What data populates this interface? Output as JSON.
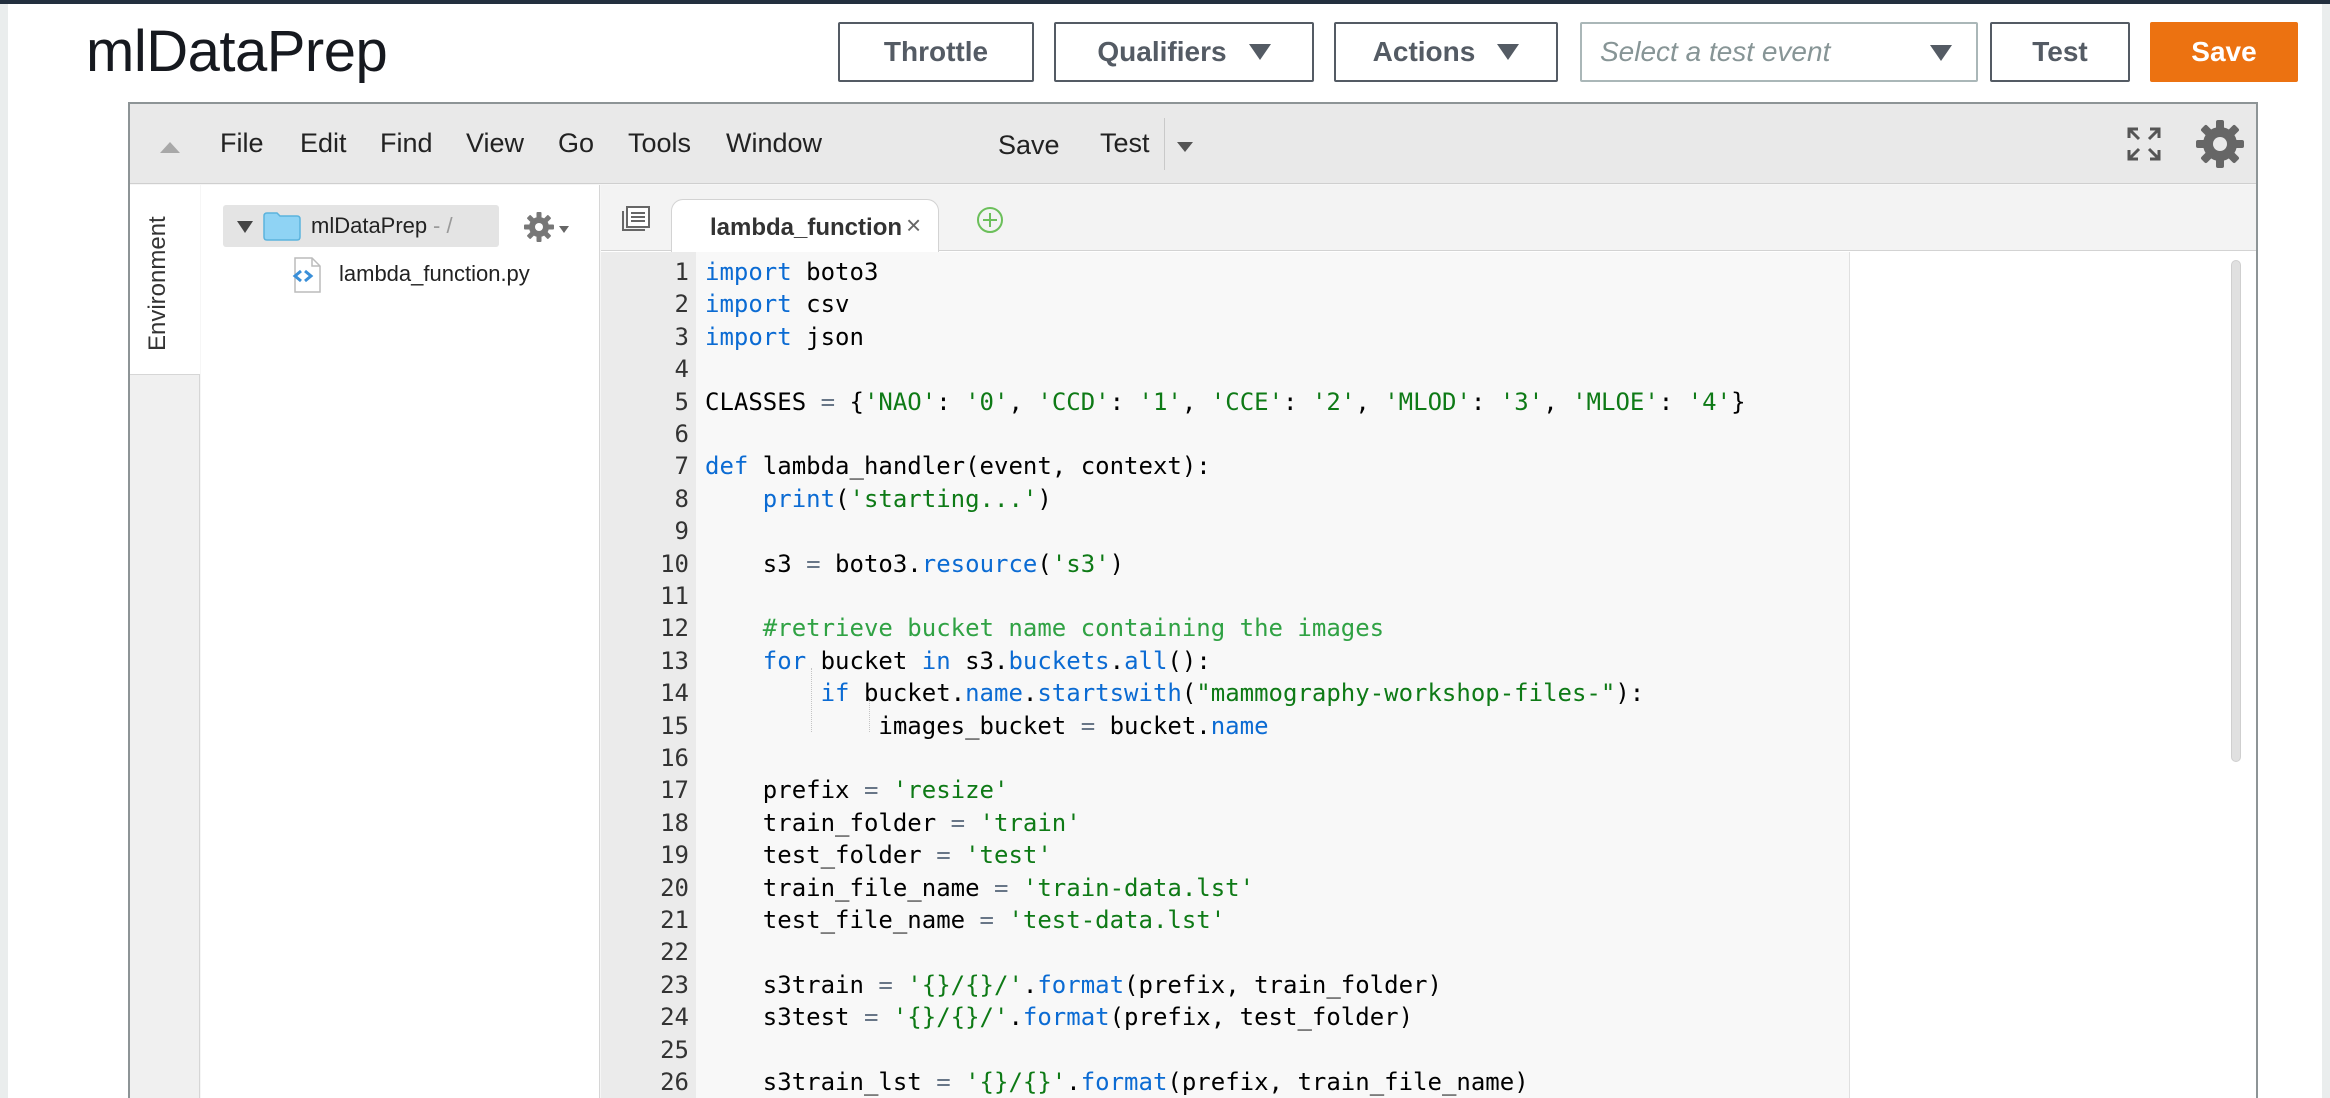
{
  "header": {
    "title": "mlDataPrep",
    "throttle_label": "Throttle",
    "qualifiers_label": "Qualifiers",
    "actions_label": "Actions",
    "test_event_placeholder": "Select a test event",
    "test_label": "Test",
    "save_label": "Save"
  },
  "ide": {
    "menu": [
      "File",
      "Edit",
      "Find",
      "View",
      "Go",
      "Tools",
      "Window"
    ],
    "menu_save": "Save",
    "menu_test": "Test",
    "sidebar_tab": "Environment",
    "tree": {
      "root": "mlDataPrep",
      "root_sep": "- /",
      "file": "lambda_function.py"
    },
    "active_tab": "lambda_function",
    "tab_close": "×"
  },
  "code": {
    "lines": [
      [
        [
          "kw",
          "import"
        ],
        [
          "t",
          " boto3"
        ]
      ],
      [
        [
          "kw",
          "import"
        ],
        [
          "t",
          " csv"
        ]
      ],
      [
        [
          "kw",
          "import"
        ],
        [
          "t",
          " json"
        ]
      ],
      [],
      [
        [
          "t",
          "CLASSES "
        ],
        [
          "op",
          "="
        ],
        [
          "t",
          " {"
        ],
        [
          "str",
          "'NAO'"
        ],
        [
          "t",
          ": "
        ],
        [
          "str",
          "'0'"
        ],
        [
          "t",
          ", "
        ],
        [
          "str",
          "'CCD'"
        ],
        [
          "t",
          ": "
        ],
        [
          "str",
          "'1'"
        ],
        [
          "t",
          ", "
        ],
        [
          "str",
          "'CCE'"
        ],
        [
          "t",
          ": "
        ],
        [
          "str",
          "'2'"
        ],
        [
          "t",
          ", "
        ],
        [
          "str",
          "'MLOD'"
        ],
        [
          "t",
          ": "
        ],
        [
          "str",
          "'3'"
        ],
        [
          "t",
          ", "
        ],
        [
          "str",
          "'MLOE'"
        ],
        [
          "t",
          ": "
        ],
        [
          "str",
          "'4'"
        ],
        [
          "t",
          "}"
        ]
      ],
      [],
      [
        [
          "kw",
          "def"
        ],
        [
          "t",
          " lambda_handler(event, context):"
        ]
      ],
      [
        [
          "t",
          "    "
        ],
        [
          "fn",
          "print"
        ],
        [
          "t",
          "("
        ],
        [
          "str",
          "'starting...'"
        ],
        [
          "t",
          ")"
        ]
      ],
      [],
      [
        [
          "t",
          "    s3 "
        ],
        [
          "op",
          "="
        ],
        [
          "t",
          " boto3."
        ],
        [
          "fn",
          "resource"
        ],
        [
          "t",
          "("
        ],
        [
          "str",
          "'s3'"
        ],
        [
          "t",
          ")"
        ]
      ],
      [],
      [
        [
          "t",
          "    "
        ],
        [
          "cm",
          "#retrieve bucket name containing the images"
        ]
      ],
      [
        [
          "t",
          "    "
        ],
        [
          "kw",
          "for"
        ],
        [
          "t",
          " bucket "
        ],
        [
          "kw",
          "in"
        ],
        [
          "t",
          " s3."
        ],
        [
          "fn",
          "buckets"
        ],
        [
          "t",
          "."
        ],
        [
          "fn",
          "all"
        ],
        [
          "t",
          "():"
        ]
      ],
      [
        [
          "t",
          "        "
        ],
        [
          "kw",
          "if"
        ],
        [
          "t",
          " bucket."
        ],
        [
          "fn",
          "name"
        ],
        [
          "t",
          "."
        ],
        [
          "fn",
          "startswith"
        ],
        [
          "t",
          "("
        ],
        [
          "str",
          "\"mammography-workshop-files-\""
        ],
        [
          "t",
          "):"
        ]
      ],
      [
        [
          "t",
          "            images_bucket "
        ],
        [
          "op",
          "="
        ],
        [
          "t",
          " bucket."
        ],
        [
          "fn",
          "name"
        ]
      ],
      [],
      [
        [
          "t",
          "    prefix "
        ],
        [
          "op",
          "="
        ],
        [
          "t",
          " "
        ],
        [
          "str",
          "'resize'"
        ]
      ],
      [
        [
          "t",
          "    train_folder "
        ],
        [
          "op",
          "="
        ],
        [
          "t",
          " "
        ],
        [
          "str",
          "'train'"
        ]
      ],
      [
        [
          "t",
          "    test_folder "
        ],
        [
          "op",
          "="
        ],
        [
          "t",
          " "
        ],
        [
          "str",
          "'test'"
        ]
      ],
      [
        [
          "t",
          "    train_file_name "
        ],
        [
          "op",
          "="
        ],
        [
          "t",
          " "
        ],
        [
          "str",
          "'train-data.lst'"
        ]
      ],
      [
        [
          "t",
          "    test_file_name "
        ],
        [
          "op",
          "="
        ],
        [
          "t",
          " "
        ],
        [
          "str",
          "'test-data.lst'"
        ]
      ],
      [],
      [
        [
          "t",
          "    s3train "
        ],
        [
          "op",
          "="
        ],
        [
          "t",
          " "
        ],
        [
          "str",
          "'{}/{}/'"
        ],
        [
          "t",
          "."
        ],
        [
          "fn",
          "format"
        ],
        [
          "t",
          "(prefix, train_folder)"
        ]
      ],
      [
        [
          "t",
          "    s3test "
        ],
        [
          "op",
          "="
        ],
        [
          "t",
          " "
        ],
        [
          "str",
          "'{}/{}/'"
        ],
        [
          "t",
          "."
        ],
        [
          "fn",
          "format"
        ],
        [
          "t",
          "(prefix, test_folder)"
        ]
      ],
      [],
      [
        [
          "t",
          "    s3train_lst "
        ],
        [
          "op",
          "="
        ],
        [
          "t",
          " "
        ],
        [
          "str",
          "'{}/{}'"
        ],
        [
          "t",
          "."
        ],
        [
          "fn",
          "format"
        ],
        [
          "t",
          "(prefix, train_file_name)"
        ]
      ]
    ]
  }
}
